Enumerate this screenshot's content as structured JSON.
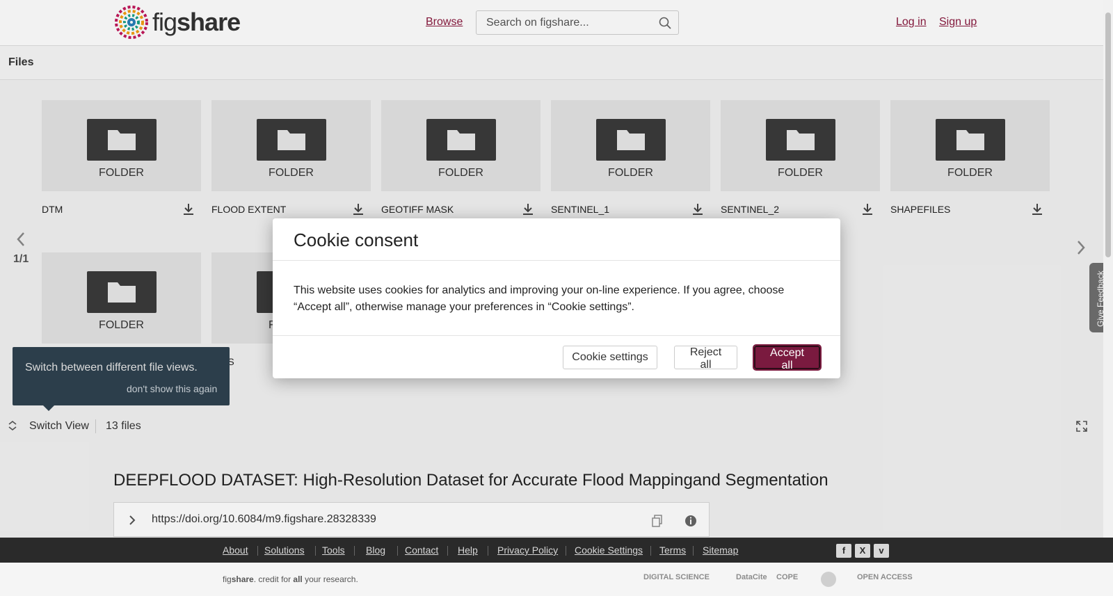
{
  "header": {
    "logo_text_light": "fig",
    "logo_text_bold": "share",
    "browse": "Browse",
    "search_placeholder": "Search on figshare...",
    "login": "Log in",
    "signup": "Sign up"
  },
  "files_panel": {
    "title": "Files",
    "folder_label": "FOLDER",
    "items": [
      {
        "name": "DTM"
      },
      {
        "name": "FLOOD EXTENT"
      },
      {
        "name": "GEOTIFF MASK"
      },
      {
        "name": "SENTINEL_1"
      },
      {
        "name": "SENTINEL_2"
      },
      {
        "name": "SHAPEFILES"
      }
    ],
    "partial_row": [
      {
        "label": "FOLDER"
      },
      {
        "label": "F",
        "name_suffix": "ES"
      }
    ],
    "pager": "1/1",
    "give_feedback": "Give Feedback"
  },
  "tooltip": {
    "text": "Switch between different file views.",
    "dismiss": "don't show this again"
  },
  "toolbar": {
    "switch_view": "Switch View",
    "file_count": "13 files"
  },
  "dataset": {
    "title": "DEEPFLOOD DATASET: High-Resolution Dataset for Accurate Flood Mappingand Segmentation",
    "doi": "https://doi.org/10.6084/m9.figshare.28328339"
  },
  "cookie_modal": {
    "title": "Cookie consent",
    "body": "This website uses cookies for analytics and improving your on-line experience. If you agree, choose “Accept all”, otherwise manage your preferences in “Cookie settings”.",
    "settings_button": "Cookie settings",
    "reject_button": "Reject all",
    "accept_button": "Accept all"
  },
  "footer": {
    "links": [
      "About",
      "Solutions",
      "Tools",
      "Blog",
      "Contact",
      "Help",
      "Privacy Policy",
      "Cookie Settings",
      "Terms",
      "Sitemap"
    ],
    "credit_pre": "fig",
    "credit_bold": "share",
    "credit_mid": ". credit for ",
    "credit_all": "all",
    "credit_post": " your research.",
    "partners": [
      "DIGITAL SCIENCE",
      "DataCite",
      "COPE",
      "OPEN ACCESS"
    ],
    "social": [
      "f",
      "X",
      "v"
    ]
  },
  "colors": {
    "accent": "#7a1a3f",
    "footer_dark": "#2a2a2a",
    "tooltip_bg": "#2f4250"
  }
}
